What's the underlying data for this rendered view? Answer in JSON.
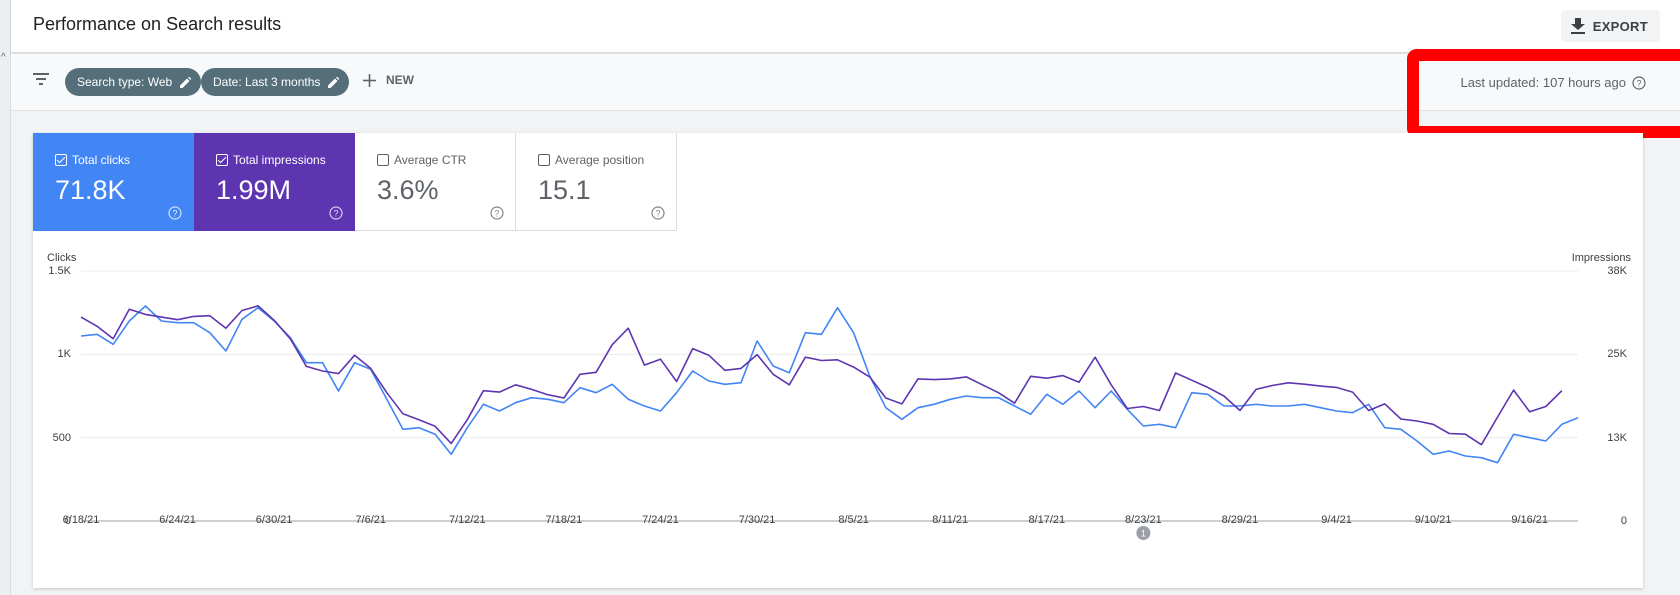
{
  "header": {
    "title": "Performance on Search results",
    "export_label": "EXPORT"
  },
  "filters": {
    "chips": [
      "Search type: Web",
      "Date: Last 3 months"
    ],
    "new_label": "NEW",
    "last_updated": "Last updated: 107 hours ago"
  },
  "metrics": [
    {
      "label": "Total clicks",
      "value": "71.8K",
      "checked": true,
      "color": "#4285f4"
    },
    {
      "label": "Total impressions",
      "value": "1.99M",
      "checked": true,
      "color": "#5e35b1"
    },
    {
      "label": "Average CTR",
      "value": "3.6%",
      "checked": false
    },
    {
      "label": "Average position",
      "value": "15.1",
      "checked": false
    }
  ],
  "chart_data": {
    "type": "line",
    "ylabel_left": "Clicks",
    "ylabel_right": "Impressions",
    "yticks_left": [
      "1.5K",
      "1K",
      "500",
      "0"
    ],
    "yticks_right": [
      "38K",
      "25K",
      "13K",
      "0"
    ],
    "ylim_left": [
      0,
      1500
    ],
    "ylim_right": [
      0,
      38000
    ],
    "xticks": [
      "6/18/21",
      "6/24/21",
      "6/30/21",
      "7/6/21",
      "7/12/21",
      "7/18/21",
      "7/24/21",
      "7/30/21",
      "8/5/21",
      "8/11/21",
      "8/17/21",
      "8/23/21",
      "8/29/21",
      "9/4/21",
      "9/10/21",
      "9/16/21"
    ],
    "annotation": {
      "label": "1",
      "date": "8/23/21"
    },
    "grid": true,
    "series": [
      {
        "name": "Total clicks",
        "color": "#4285f4",
        "axis": "left",
        "values": [
          1110,
          1120,
          1060,
          1200,
          1290,
          1200,
          1190,
          1190,
          1130,
          1020,
          1210,
          1280,
          1200,
          1100,
          950,
          950,
          780,
          950,
          910,
          730,
          550,
          560,
          520,
          400,
          560,
          700,
          660,
          710,
          740,
          730,
          710,
          800,
          770,
          820,
          730,
          690,
          660,
          770,
          900,
          840,
          820,
          830,
          1080,
          930,
          890,
          1130,
          1120,
          1280,
          1130,
          870,
          680,
          610,
          680,
          700,
          730,
          750,
          740,
          740,
          690,
          640,
          760,
          700,
          780,
          680,
          780,
          670,
          570,
          580,
          560,
          770,
          760,
          690,
          690,
          700,
          690,
          690,
          700,
          680,
          660,
          650,
          700,
          560,
          550,
          480,
          400,
          420,
          390,
          380,
          350,
          520,
          500,
          480,
          580,
          620
        ]
      },
      {
        "name": "Total impressions",
        "color": "#5e35b1",
        "axis": "right",
        "values": [
          31000,
          29600,
          27700,
          32200,
          31400,
          31000,
          30600,
          31100,
          31200,
          29300,
          32000,
          32700,
          30500,
          27700,
          23500,
          22800,
          22400,
          25200,
          23200,
          19500,
          16300,
          15400,
          14400,
          11800,
          15400,
          19800,
          19600,
          20700,
          20000,
          19200,
          18700,
          22300,
          22600,
          26800,
          29300,
          23700,
          24600,
          21200,
          26200,
          25200,
          22900,
          23200,
          25300,
          22300,
          20700,
          24900,
          24400,
          24500,
          23400,
          21900,
          18700,
          17800,
          21600,
          21500,
          21600,
          21900,
          20700,
          19500,
          17900,
          22000,
          21700,
          22100,
          21100,
          24900,
          20700,
          17100,
          17400,
          16800,
          22500,
          21400,
          20300,
          19000,
          16800,
          20000,
          20600,
          21000,
          20800,
          20500,
          20300,
          19600,
          16800,
          17800,
          15500,
          15200,
          14700,
          13300,
          13200,
          11600,
          15800,
          19900,
          16600,
          17400,
          19800
        ]
      }
    ]
  }
}
